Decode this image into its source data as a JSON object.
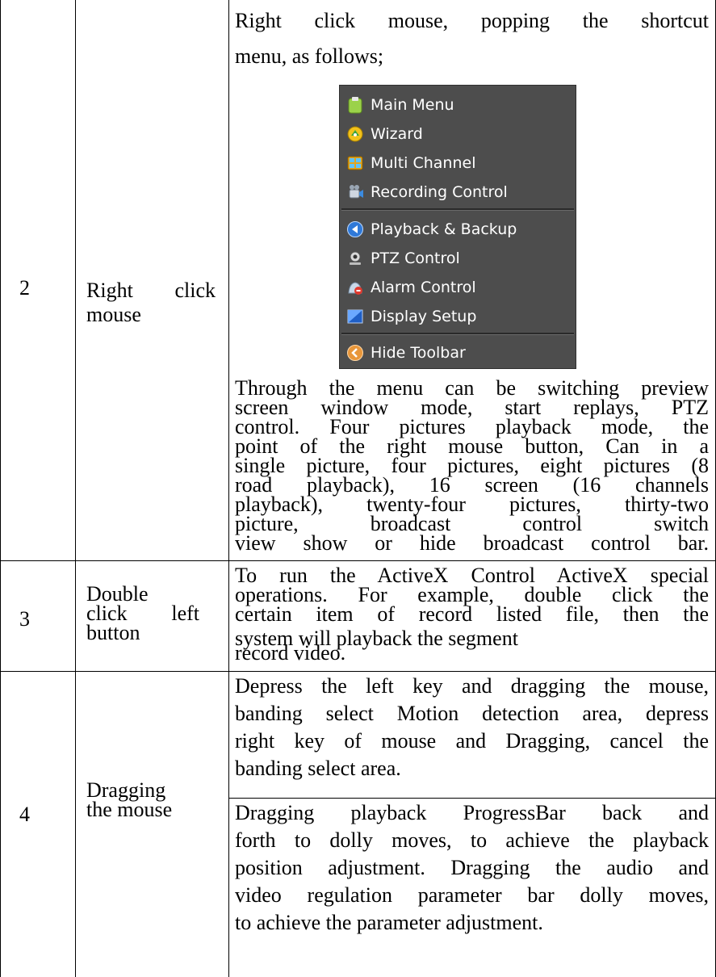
{
  "rows": [
    {
      "number": "2",
      "operation": "Right click mouse",
      "intro_line1": "Right click mouse, popping the shortcut",
      "intro_line2": "menu, as follows;",
      "description": [
        "Through the menu can be switching preview",
        "screen window mode, start replays, PTZ",
        "control. Four pictures playback mode, the",
        "point of the right mouse button, Can in a",
        "single picture, four pictures, eight pictures (8",
        "road playback), 16 screen (16 channels",
        "playback), twenty-four pictures, thirty-two",
        "picture, broadcast control switch",
        "view show or hide broadcast control bar."
      ]
    },
    {
      "number": "3",
      "operation_lines": [
        "Double",
        "click left",
        "button"
      ],
      "description": [
        "To run the ActiveX Control ActiveX special",
        "operations. For example, double click the",
        "certain item of record listed file, then the",
        "system will playback the segment",
        "record video."
      ]
    },
    {
      "number": "4",
      "operation_lines": [
        "Dragging",
        "the mouse"
      ],
      "description_a": [
        "Depress the left key and dragging the mouse,",
        "banding select Motion detection area, depress",
        "right key of mouse and Dragging, cancel the",
        "banding select area."
      ],
      "description_b": [
        "Dragging playback ProgressBar back and",
        "forth to dolly moves, to achieve the playback",
        "position adjustment. Dragging the audio and",
        "video regulation parameter bar dolly moves,",
        "to achieve the parameter adjustment."
      ]
    }
  ],
  "menu": {
    "items": [
      {
        "label": "Main Menu",
        "icon": "clipboard-icon"
      },
      {
        "label": "Wizard",
        "icon": "wizard-icon"
      },
      {
        "label": "Multi Channel",
        "icon": "multi-channel-icon"
      },
      {
        "label": "Recording Control",
        "icon": "recording-icon"
      },
      {
        "label": "Playback & Backup",
        "icon": "playback-icon"
      },
      {
        "label": "PTZ Control",
        "icon": "ptz-camera-icon"
      },
      {
        "label": "Alarm Control",
        "icon": "alarm-icon"
      },
      {
        "label": "Display Setup",
        "icon": "display-icon"
      },
      {
        "label": "Hide Toolbar",
        "icon": "hide-toolbar-icon"
      }
    ]
  }
}
